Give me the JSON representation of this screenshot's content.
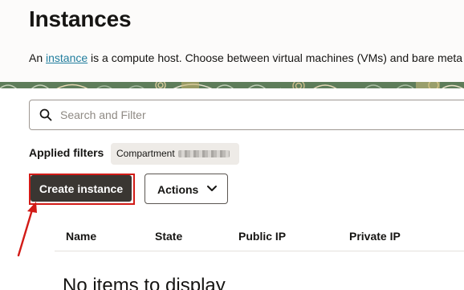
{
  "page": {
    "title": "Instances",
    "intro_prefix": "An ",
    "intro_link": "instance",
    "intro_suffix": " is a compute host. Choose between virtual machines (VMs) and bare meta"
  },
  "search": {
    "placeholder": "Search and Filter",
    "value": ""
  },
  "filters": {
    "label": "Applied filters",
    "chips": [
      {
        "text": "Compartment",
        "value_redacted": true
      }
    ]
  },
  "toolbar": {
    "create_label": "Create instance",
    "actions_label": "Actions"
  },
  "table": {
    "columns": [
      "Name",
      "State",
      "Public IP",
      "Private IP"
    ],
    "rows": [],
    "empty_message": "No items to display"
  },
  "annotation": {
    "highlight_color": "#d21b17",
    "arrow_color": "#d21b17"
  },
  "icons": {
    "search": "search-icon",
    "actions_menu": "chevron-down-icon",
    "pointer": "red-arrow-icon"
  },
  "colors": {
    "link": "#227e9e",
    "primary_button": "#3a3632",
    "annotation_red": "#d21b17"
  }
}
